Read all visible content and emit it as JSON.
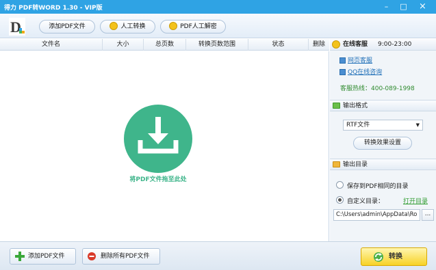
{
  "window": {
    "title": "得力 PDF转WORD 1.30 - VIP版",
    "controls": [
      "minimize-icon",
      "maximize-icon",
      "close-icon"
    ]
  },
  "toolbar": {
    "logo_letter": "D",
    "buttons": [
      {
        "label": "添加PDF文件"
      },
      {
        "label": "人工转换"
      },
      {
        "label": "PDF人工解密"
      }
    ]
  },
  "table": {
    "columns": [
      "文件名",
      "大小",
      "总页数",
      "转换页数范围",
      "状态",
      "删除"
    ]
  },
  "dropzone": {
    "text": "将PDF文件拖至此处",
    "icon": "download-icon",
    "color": "#3fb58b"
  },
  "support": {
    "title": "在线客服",
    "hours": "9:00-23:00",
    "web_link": "网页客服",
    "qq_link": "QQ在线咨询",
    "hotline": "客服热线：400-089-1998"
  },
  "output_format": {
    "title": "输出格式",
    "selected": "RTF文件",
    "settings_button": "转换效果设置"
  },
  "output_dir": {
    "title": "输出目录",
    "option_same": "保存到PDF相同的目录",
    "option_custom": "自定义目录：",
    "open_link": "打开目录",
    "path": "C:\\Users\\admin\\AppData\\Ro",
    "browse": "..."
  },
  "bottom": {
    "add_button": "添加PDF文件",
    "delete_button": "删除所有PDF文件",
    "convert_button": "转换"
  },
  "colors": {
    "titlebar": "#2fa3e4",
    "accent_green": "#3fb58b",
    "link_blue": "#1f6fb8",
    "convert_yellow": "#f7d226"
  }
}
